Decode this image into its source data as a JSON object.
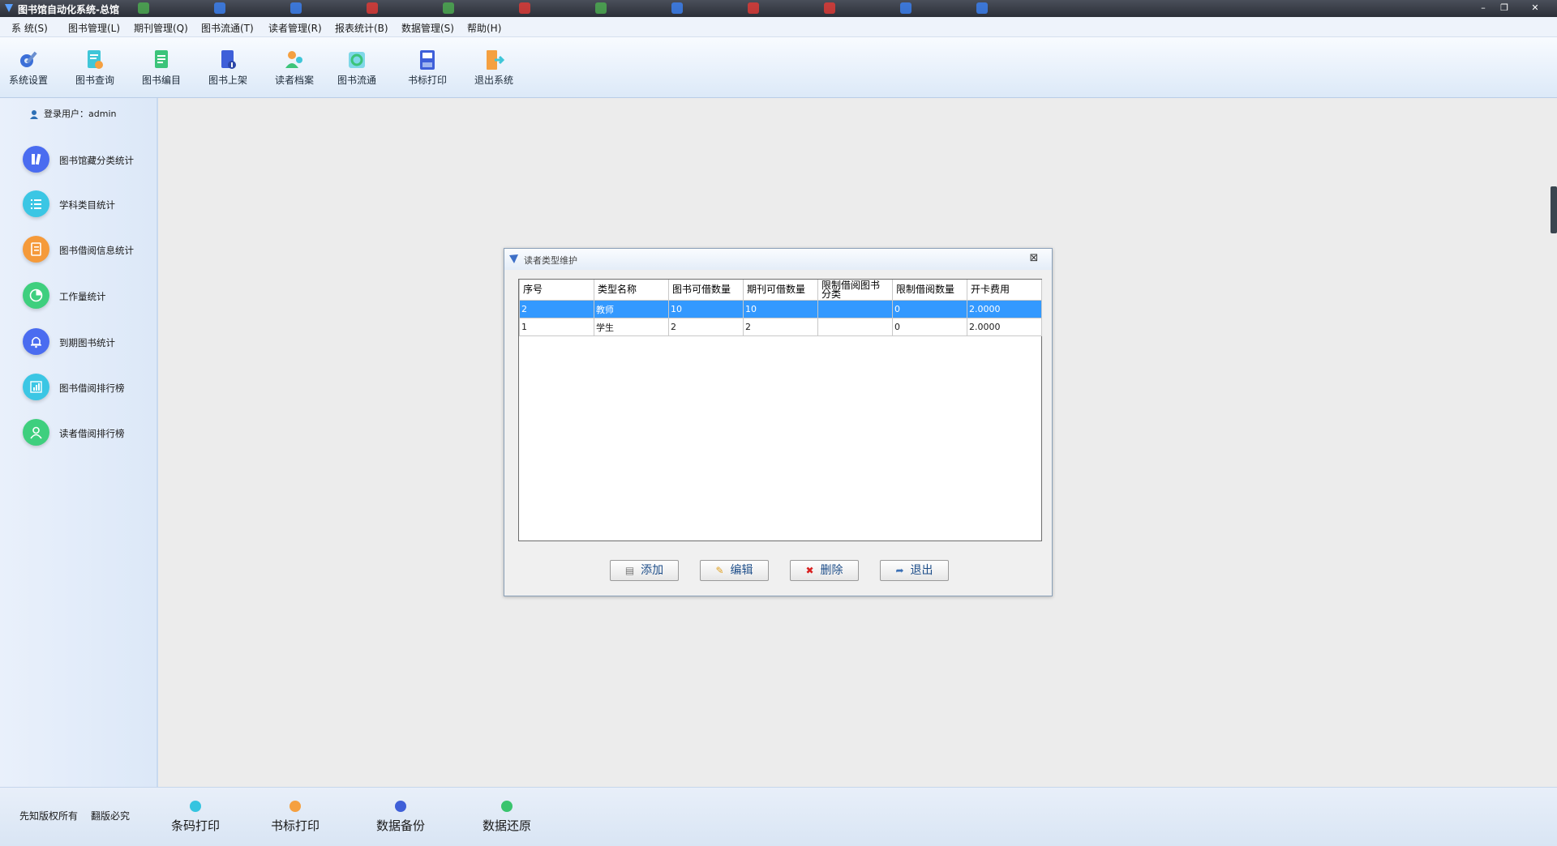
{
  "window": {
    "title": "图书馆自动化系统-总馆"
  },
  "menu": [
    "系  统(S)",
    "图书管理(L)",
    "期刊管理(Q)",
    "图书流通(T)",
    "读者管理(R)",
    "报表统计(B)",
    "数据管理(S)",
    "帮助(H)"
  ],
  "toolbar": [
    {
      "label": "系统设置",
      "icon": "gear-icon"
    },
    {
      "label": "图书查询",
      "icon": "book-search-icon"
    },
    {
      "label": "图书编目",
      "icon": "catalog-icon"
    },
    {
      "label": "图书上架",
      "icon": "shelf-icon"
    },
    {
      "label": "读者档案",
      "icon": "reader-icon"
    },
    {
      "label": "图书流通",
      "icon": "circulation-icon"
    },
    {
      "label": "书标打印",
      "icon": "printer-icon"
    },
    {
      "label": "退出系统",
      "icon": "exit-icon"
    }
  ],
  "sidebar": {
    "login_label": "登录用户：admin",
    "items": [
      {
        "label": "图书馆藏分类统计",
        "icon": "books-icon",
        "color": "#4a6cf0"
      },
      {
        "label": "学科类目统计",
        "icon": "list-icon",
        "color": "#3bc6e4"
      },
      {
        "label": "图书借阅信息统计",
        "icon": "document-icon",
        "color": "#f59a3a"
      },
      {
        "label": "工作量统计",
        "icon": "pie-chart-icon",
        "color": "#3ecf7e"
      },
      {
        "label": "到期图书统计",
        "icon": "bell-icon",
        "color": "#4a6cf0"
      },
      {
        "label": "图书借阅排行榜",
        "icon": "bar-chart-icon",
        "color": "#3bc6e4"
      },
      {
        "label": "读者借阅排行榜",
        "icon": "user-icon",
        "color": "#3ecf7e"
      }
    ]
  },
  "dialog": {
    "title": "读者类型维护",
    "columns": [
      "序号",
      "类型名称",
      "图书可借数量",
      "期刊可借数量",
      "限制借阅图书分类",
      "限制借阅数量",
      "开卡费用"
    ],
    "rows": [
      [
        "2",
        "教师",
        "10",
        "10",
        "",
        "0",
        "2.0000"
      ],
      [
        "1",
        "学生",
        "2",
        "2",
        "",
        "0",
        "2.0000"
      ]
    ],
    "buttons": {
      "add": "添加",
      "edit": "编辑",
      "delete": "删除",
      "exit": "退出"
    }
  },
  "footer": {
    "copyright_1": "先知版权所有",
    "copyright_2": "翻版必究",
    "buttons": [
      {
        "label": "条码打印",
        "color": "#35c4e0"
      },
      {
        "label": "书标打印",
        "color": "#f5a040"
      },
      {
        "label": "数据备份",
        "color": "#3f5fd8"
      },
      {
        "label": "数据还原",
        "color": "#39c46e"
      }
    ]
  }
}
